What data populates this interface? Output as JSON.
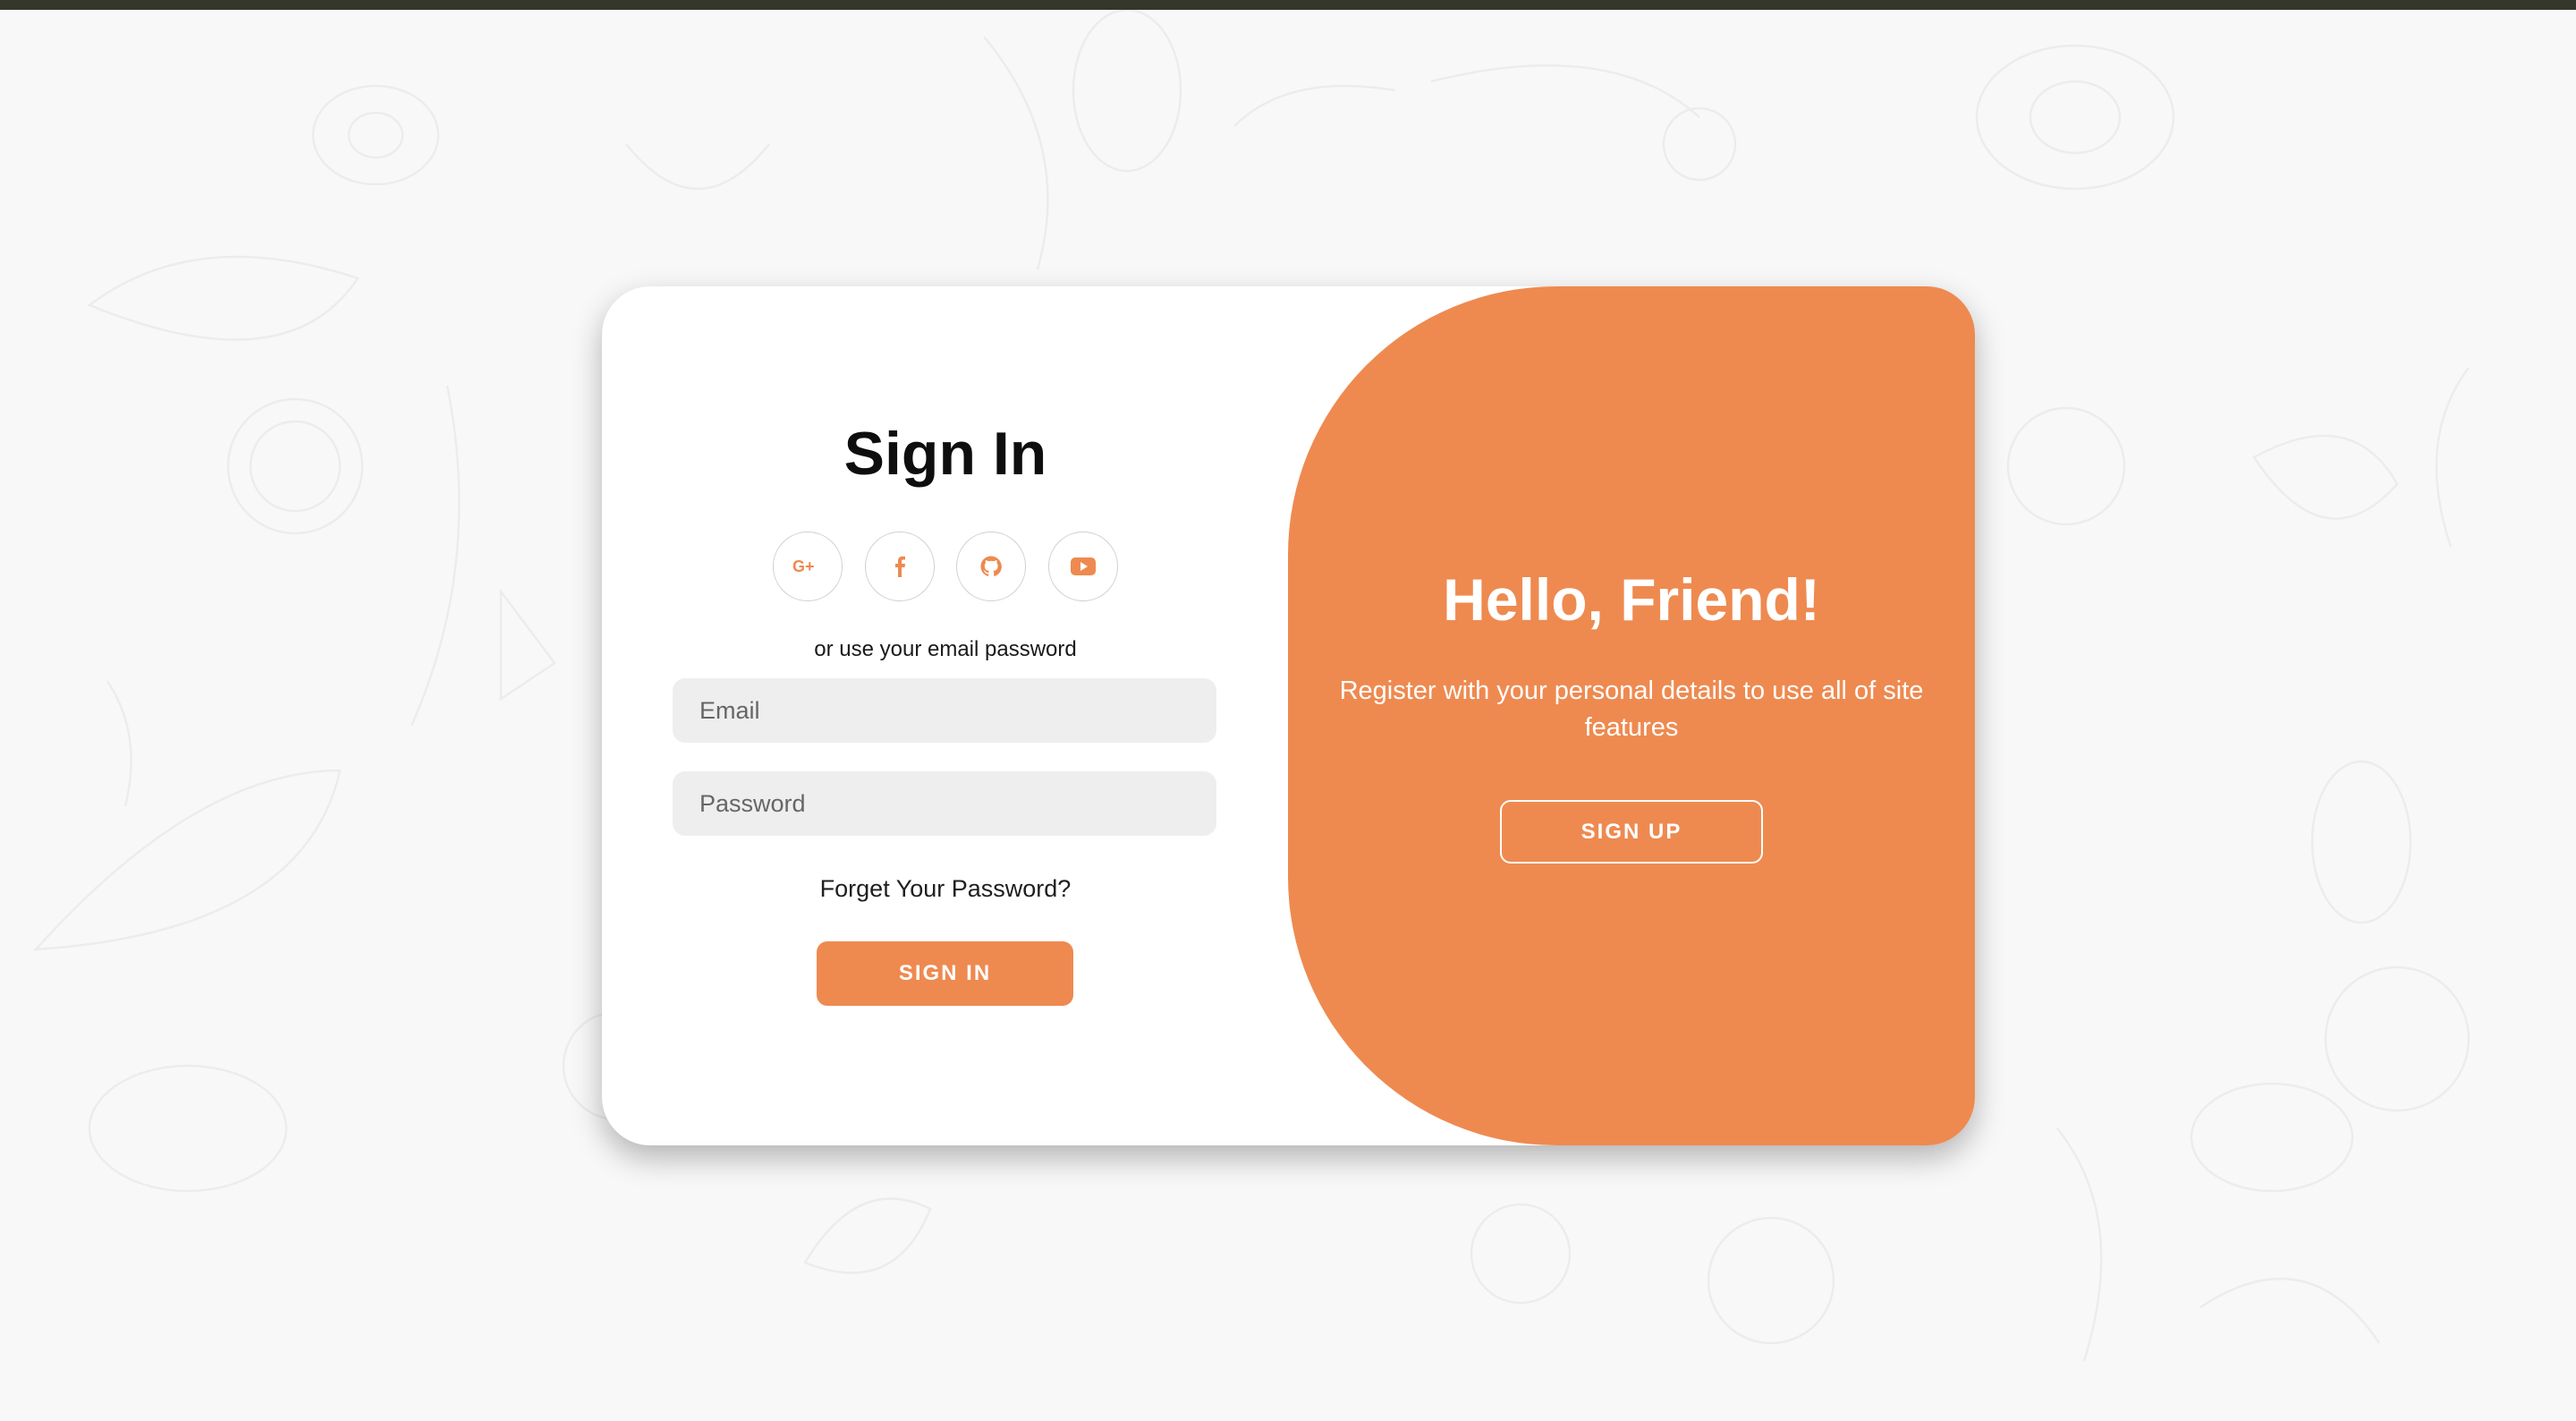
{
  "signin": {
    "title": "Sign In",
    "social_buttons": [
      {
        "icon": "google-plus-icon",
        "glyph": "G+"
      },
      {
        "icon": "facebook-icon",
        "glyph": "f"
      },
      {
        "icon": "github-icon",
        "glyph": ""
      },
      {
        "icon": "youtube-icon",
        "glyph": ""
      }
    ],
    "subtext": "or use your email password",
    "email_placeholder": "Email",
    "email_value": "",
    "password_placeholder": "Password",
    "password_value": "",
    "forgot_link": "Forget Your Password?",
    "signin_button": "SIGN IN"
  },
  "panel": {
    "title": "Hello, Friend!",
    "text": "Register with your personal details to use all of site features",
    "signup_button": "SIGN UP"
  },
  "colors": {
    "accent": "#ee8a50",
    "top_bar": "#34372a",
    "background": "#f8f8f8",
    "input_bg": "#eeeeee"
  }
}
